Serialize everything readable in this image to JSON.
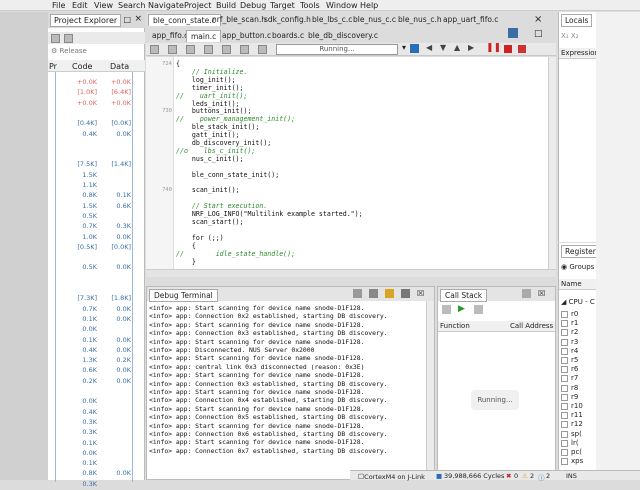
{
  "menu": [
    "File",
    "Edit",
    "View",
    "Search",
    "Navigate",
    "Project",
    "Build",
    "Debug",
    "Target",
    "Tools",
    "Window",
    "Help"
  ],
  "project_explorer": {
    "title": "Project Explorer",
    "release_label": "Release",
    "columns": [
      "Pr",
      "Code",
      "Data"
    ],
    "rows": [
      {
        "code": "+0.0K",
        "data": "+0.0K",
        "color": "#e06060"
      },
      {
        "code": "[1.0K]",
        "data": "[6.4K]",
        "color": "#e06060"
      },
      {
        "code": "+0.0K",
        "data": "+0.0K",
        "color": "#e06060"
      },
      {
        "code": "",
        "data": "",
        "color": "#3a6ea5"
      },
      {
        "code": "[0.4K]",
        "data": "[0.0K]",
        "color": "#3a6ea5"
      },
      {
        "code": "0.4K",
        "data": "0.0K",
        "color": "#3a6ea5"
      },
      {
        "code": "",
        "data": "",
        "color": "#3a6ea5"
      },
      {
        "code": "",
        "data": "",
        "color": "#3a6ea5"
      },
      {
        "code": "[7.5K]",
        "data": "[1.4K]",
        "color": "#3a6ea5"
      },
      {
        "code": "1.5K",
        "data": "",
        "color": "#3a6ea5"
      },
      {
        "code": "1.1K",
        "data": "",
        "color": "#3a6ea5"
      },
      {
        "code": "0.8K",
        "data": "0.1K",
        "color": "#3a6ea5"
      },
      {
        "code": "1.5K",
        "data": "0.6K",
        "color": "#3a6ea5"
      },
      {
        "code": "0.5K",
        "data": "",
        "color": "#3a6ea5"
      },
      {
        "code": "0.7K",
        "data": "0.3K",
        "color": "#3a6ea5"
      },
      {
        "code": "1.0K",
        "data": "0.0K",
        "color": "#3a6ea5"
      },
      {
        "code": "[0.5K]",
        "data": "[0.0K]",
        "color": "#3a6ea5"
      },
      {
        "code": "",
        "data": "",
        "color": "#3a6ea5"
      },
      {
        "code": "0.5K",
        "data": "0.0K",
        "color": "#3a6ea5"
      },
      {
        "code": "",
        "data": "",
        "color": "#3a6ea5"
      },
      {
        "code": "",
        "data": "",
        "color": "#3a6ea5"
      },
      {
        "code": "[7.3K]",
        "data": "[1.8K]",
        "color": "#3a6ea5"
      },
      {
        "code": "0.7K",
        "data": "0.0K",
        "color": "#3a6ea5"
      },
      {
        "code": "0.1K",
        "data": "0.0K",
        "color": "#3a6ea5"
      },
      {
        "code": "0.0K",
        "data": "",
        "color": "#3a6ea5"
      },
      {
        "code": "0.1K",
        "data": "0.0K",
        "color": "#3a6ea5"
      },
      {
        "code": "0.4K",
        "data": "0.0K",
        "color": "#3a6ea5"
      },
      {
        "code": "1.3K",
        "data": "0.2K",
        "color": "#3a6ea5"
      },
      {
        "code": "0.6K",
        "data": "0.0K",
        "color": "#3a6ea5"
      },
      {
        "code": "0.2K",
        "data": "0.0K",
        "color": "#3a6ea5"
      },
      {
        "code": "",
        "data": "",
        "color": "#3a6ea5"
      },
      {
        "code": "0.0K",
        "data": "",
        "color": "#3a6ea5"
      },
      {
        "code": "0.4K",
        "data": "",
        "color": "#3a6ea5"
      },
      {
        "code": "0.3K",
        "data": "",
        "color": "#3a6ea5"
      },
      {
        "code": "0.3K",
        "data": "",
        "color": "#3a6ea5"
      },
      {
        "code": "0.1K",
        "data": "",
        "color": "#3a6ea5"
      },
      {
        "code": "0.0K",
        "data": "",
        "color": "#3a6ea5"
      },
      {
        "code": "0.1K",
        "data": "",
        "color": "#3a6ea5"
      },
      {
        "code": "0.8K",
        "data": "0.0K",
        "color": "#3a6ea5"
      },
      {
        "code": "0.3K",
        "data": "",
        "color": "#3a6ea5"
      }
    ]
  },
  "editor_tabs_row1": [
    "ble_conn_state.c",
    "nrf_ble_scan.h",
    "sdk_config.h",
    "ble_lbs_c.c",
    "ble_nus_c.c",
    "ble_nus_c.h",
    "app_uart_fifo.c"
  ],
  "editor_tabs_row2": [
    "app_fifo.c",
    "main.c",
    "app_button.c",
    "boards.c",
    "ble_db_discovery.c"
  ],
  "toolbar": {
    "status_text": "Running..."
  },
  "code": [
    {
      "ln": "724",
      "text": "{",
      "comment": false
    },
    {
      "ln": "",
      "text": "    // Initialize.",
      "comment": true
    },
    {
      "ln": "",
      "text": "    log_init();",
      "comment": false
    },
    {
      "ln": "",
      "text": "    timer_init();",
      "comment": false
    },
    {
      "ln": "",
      "text": "//    uart_init();",
      "comment": true
    },
    {
      "ln": "",
      "text": "    leds_init();",
      "comment": false
    },
    {
      "ln": "730",
      "text": "    buttons_init();",
      "comment": false
    },
    {
      "ln": "",
      "text": "//    power_management_init();",
      "comment": true
    },
    {
      "ln": "",
      "text": "    ble_stack_init();",
      "comment": false
    },
    {
      "ln": "",
      "text": "    gatt_init();",
      "comment": false
    },
    {
      "ln": "",
      "text": "    db_discovery_init();",
      "comment": false
    },
    {
      "ln": "",
      "text": "//o    lbs_c_init();",
      "comment": true
    },
    {
      "ln": "",
      "text": "    nus_c_init();",
      "comment": false
    },
    {
      "ln": "",
      "text": "",
      "comment": false
    },
    {
      "ln": "",
      "text": "    ble_conn_state_init();",
      "comment": false
    },
    {
      "ln": "",
      "text": "",
      "comment": false
    },
    {
      "ln": "740",
      "text": "    scan_init();",
      "comment": false
    },
    {
      "ln": "",
      "text": "",
      "comment": false
    },
    {
      "ln": "",
      "text": "    // Start execution.",
      "comment": true
    },
    {
      "ln": "",
      "text": "    NRF_LOG_INFO(\"Multilink example started.\");",
      "comment": false
    },
    {
      "ln": "",
      "text": "    scan_start();",
      "comment": false
    },
    {
      "ln": "",
      "text": "",
      "comment": false
    },
    {
      "ln": "",
      "text": "    for (;;)",
      "comment": false
    },
    {
      "ln": "",
      "text": "    {",
      "comment": false
    },
    {
      "ln": "",
      "text": "//        idle_state_handle();",
      "comment": true
    },
    {
      "ln": "",
      "text": "    }",
      "comment": false
    }
  ],
  "debug_terminal": {
    "title": "Debug Terminal",
    "lines": [
      "<info> app: Start scanning for device name snode-D1F128.",
      "<info> app: Connection 0x2 established, starting DB discovery.",
      "<info> app: Start scanning for device name snode-D1F128.",
      "<info> app: Connection 0x3 established, starting DB discovery.",
      "<info> app: Start scanning for device name snode-D1F128.",
      "<info> app: Disconnected. NUS Server 0x2000",
      "<info> app: Start scanning for device name snode-D1F128.",
      "<info> app: central link 0x3 disconnected (reason: 0x3E)",
      "<info> app: Start scanning for device name snode-D1F128.",
      "<info> app: Connection 0x3 established, starting DB discovery.",
      "<info> app: Start scanning for device name snode-D1F128.",
      "<info> app: Connection 0x4 established, starting DB discovery.",
      "<info> app: Start scanning for device name snode-D1F128.",
      "<info> app: Connection 0x5 established, starting DB discovery.",
      "<info> app: Start scanning for device name snode-D1F128.",
      "<info> app: Connection 0x6 established, starting DB discovery.",
      "<info> app: Start scanning for device name snode-D1F128.",
      "<info> app: Connection 0x7 established, starting DB discovery."
    ]
  },
  "call_stack": {
    "title": "Call Stack",
    "columns": [
      "Function",
      "Call Address"
    ],
    "overlay_text": "Running..."
  },
  "locals": {
    "title": "Locals",
    "column": "Expression"
  },
  "registers": {
    "title": "Registers 1",
    "groups_label": "Groups",
    "name_column": "Name",
    "group_item": "CPU - C",
    "items": [
      "r0",
      "r1",
      "r2",
      "r3",
      "r4",
      "r5",
      "r6",
      "r7",
      "r8",
      "r9",
      "r10",
      "r11",
      "r12",
      "sp(",
      "lr(",
      "pc(",
      "xps"
    ]
  },
  "status_bar": {
    "target": "CortexM4 on J-Link",
    "cycles": "39,988,666 Cycles",
    "errors": "0",
    "warnings": "2",
    "info": "2",
    "mode": "INS"
  }
}
